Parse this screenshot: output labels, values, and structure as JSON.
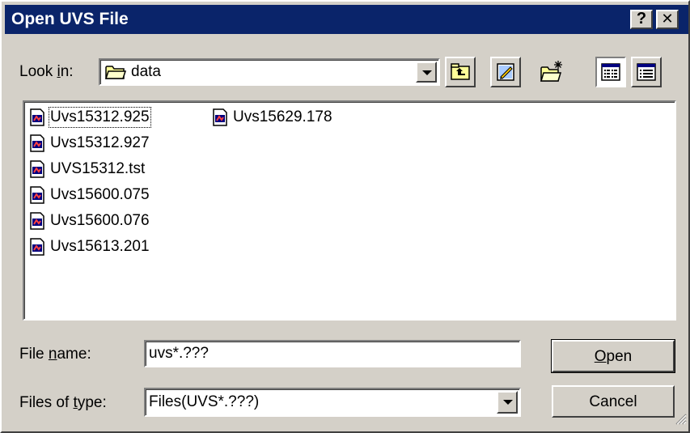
{
  "window": {
    "title": "Open UVS File",
    "help_button": "?",
    "close_button": "✕"
  },
  "look_in": {
    "label_before": "Look ",
    "label_mnemonic": "i",
    "label_after": "n:",
    "value": "data"
  },
  "files": [
    {
      "name": "Uvs15312.925"
    },
    {
      "name": "Uvs15312.927"
    },
    {
      "name": "UVS15312.tst"
    },
    {
      "name": "Uvs15600.075"
    },
    {
      "name": "Uvs15600.076"
    },
    {
      "name": "Uvs15613.201"
    },
    {
      "name": "Uvs15629.178"
    }
  ],
  "file_name": {
    "label_before": "File ",
    "label_mnemonic": "n",
    "label_after": "ame:",
    "value": "uvs*.???"
  },
  "file_type": {
    "label_before": "Files of ",
    "label_mnemonic": "t",
    "label_after": "ype:",
    "value": "Files(UVS*.???)"
  },
  "buttons": {
    "open_mnemonic": "O",
    "open_rest": "pen",
    "cancel": "Cancel"
  }
}
